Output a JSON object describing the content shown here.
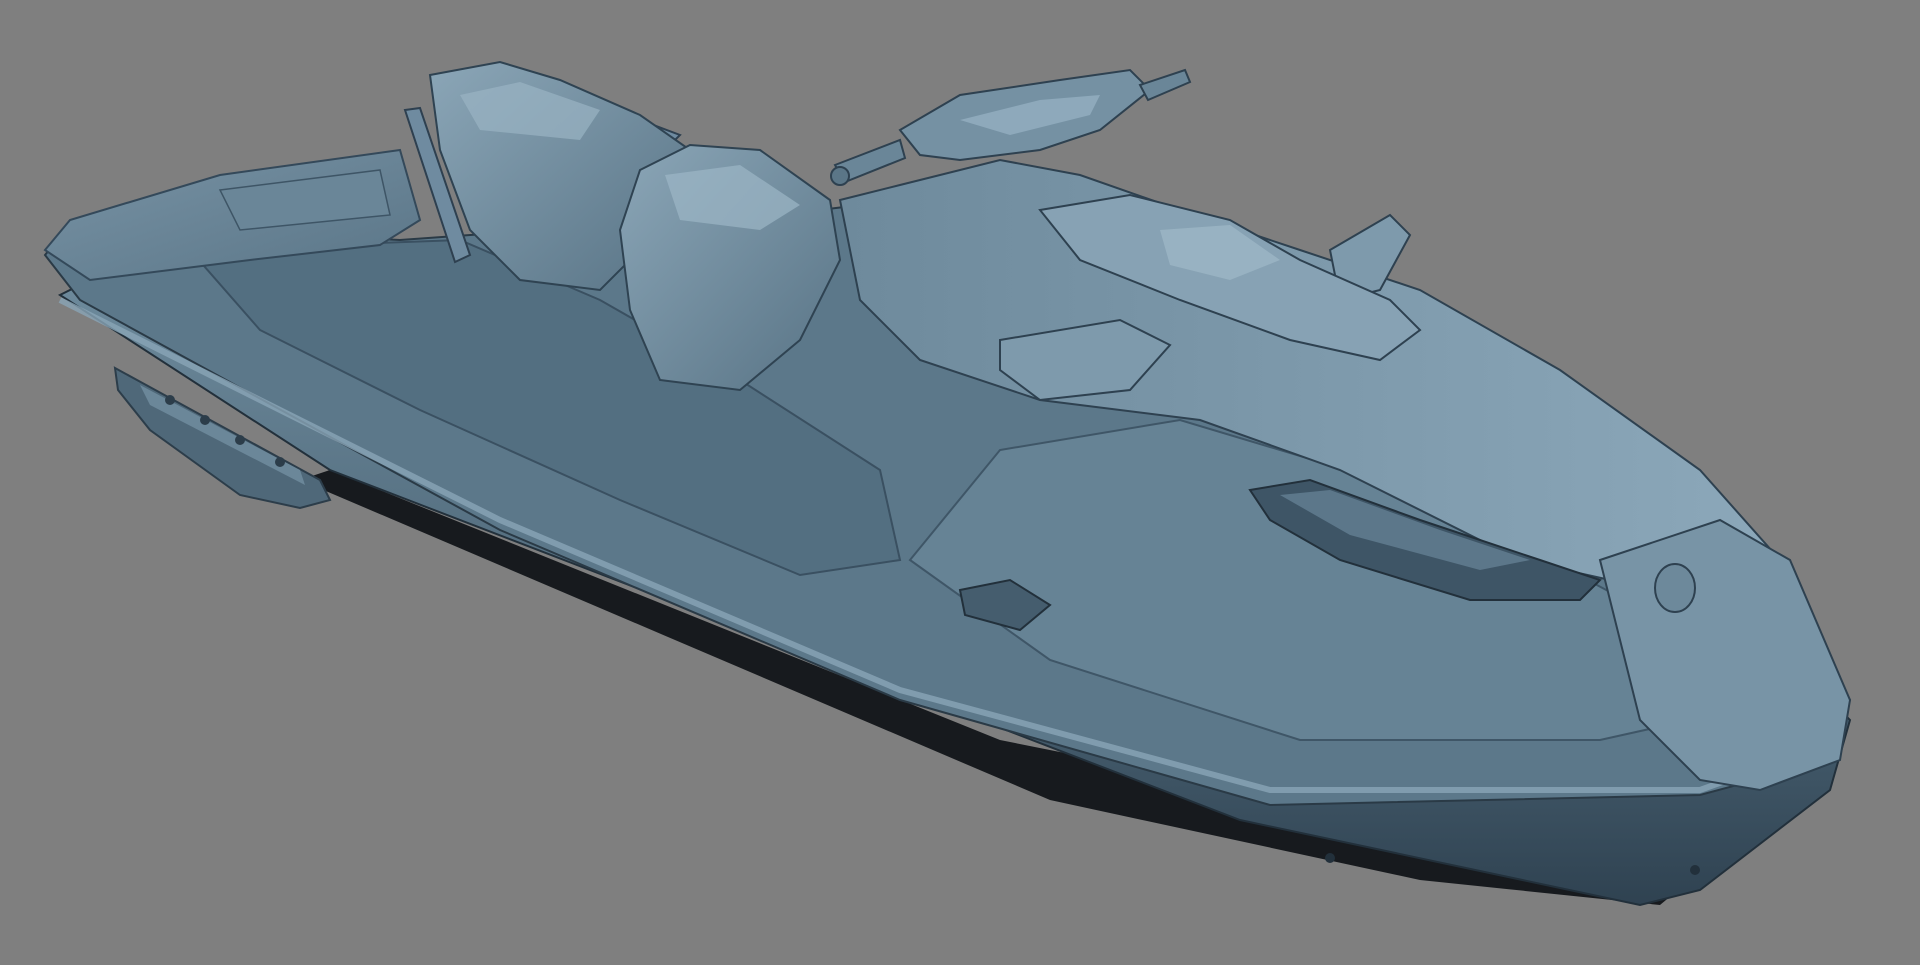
{
  "scene": {
    "subject": "jet-ski",
    "background_color": "#7f7f7f",
    "body_color": "#5f7c8e",
    "body_highlight_color": "#8aa6b8",
    "body_dark_color": "#34495a",
    "shadow_color": "#0b0e11"
  }
}
